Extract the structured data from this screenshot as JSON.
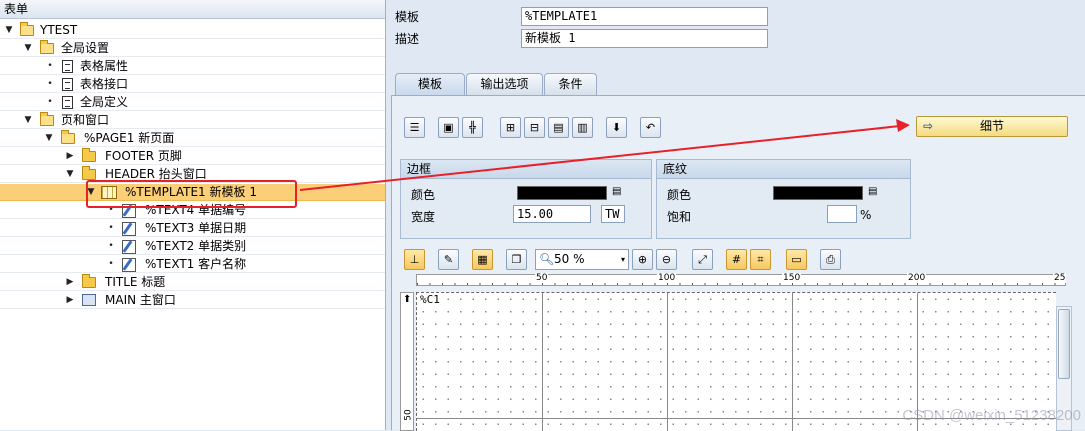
{
  "tree": {
    "header": "表单",
    "items": [
      {
        "label": "YTEST",
        "icon": "folder-open-icon",
        "toggle": "▼"
      },
      {
        "label": "全局设置",
        "icon": "folder-open-icon",
        "toggle": "▼"
      },
      {
        "label": "表格属性",
        "icon": "document-icon",
        "toggle": "•"
      },
      {
        "label": "表格接口",
        "icon": "document-icon",
        "toggle": "•"
      },
      {
        "label": "全局定义",
        "icon": "document-icon",
        "toggle": "•"
      },
      {
        "label": "页和窗口",
        "icon": "folder-open-icon",
        "toggle": "▼"
      },
      {
        "label": "%PAGE1 新页面",
        "icon": "folder-open-icon",
        "toggle": "▼"
      },
      {
        "label": "FOOTER 页脚",
        "icon": "folder-icon",
        "toggle": "▶"
      },
      {
        "label": "HEADER 抬头窗口",
        "icon": "folder-icon",
        "toggle": "▼"
      },
      {
        "label": "%TEMPLATE1 新模板 1",
        "icon": "template-grid-icon",
        "toggle": "▼"
      },
      {
        "label": "%TEXT4 单据编号",
        "icon": "text-node-icon",
        "toggle": "•"
      },
      {
        "label": "%TEXT3 单据日期",
        "icon": "text-node-icon",
        "toggle": "•"
      },
      {
        "label": "%TEXT2 单据类别",
        "icon": "text-node-icon",
        "toggle": "•"
      },
      {
        "label": "%TEXT1 客户名称",
        "icon": "text-node-icon",
        "toggle": "•"
      },
      {
        "label": "TITLE 标题",
        "icon": "folder-icon",
        "toggle": "▶"
      },
      {
        "label": "MAIN 主窗口",
        "icon": "main-window-icon",
        "toggle": "▶"
      }
    ]
  },
  "header": {
    "template_label": "模板",
    "template_value": "%TEMPLATE1",
    "desc_label": "描述",
    "desc_value": "新模板 1"
  },
  "tabs": [
    "模板",
    "输出选项",
    "条件"
  ],
  "detail_button": "细节",
  "border_group": {
    "title": "边框",
    "color_label": "颜色",
    "width_label": "宽度",
    "width_value": "15.00",
    "unit_value": "TW"
  },
  "shading_group": {
    "title": "底纹",
    "color_label": "颜色",
    "saturation_label": "饱和",
    "saturation_unit": "%"
  },
  "zoom": {
    "value": "50 %"
  },
  "ruler": {
    "labels": [
      "50",
      "100",
      "150",
      "200",
      "25"
    ],
    "vlabel": "50"
  },
  "canvas": {
    "cell_label": "%C1"
  },
  "watermark": "CSDN @weixin_51238200",
  "colors": {
    "selection": "#fbcf77",
    "highlight_box": "#e8202a",
    "panel": "#dfe8f3"
  }
}
